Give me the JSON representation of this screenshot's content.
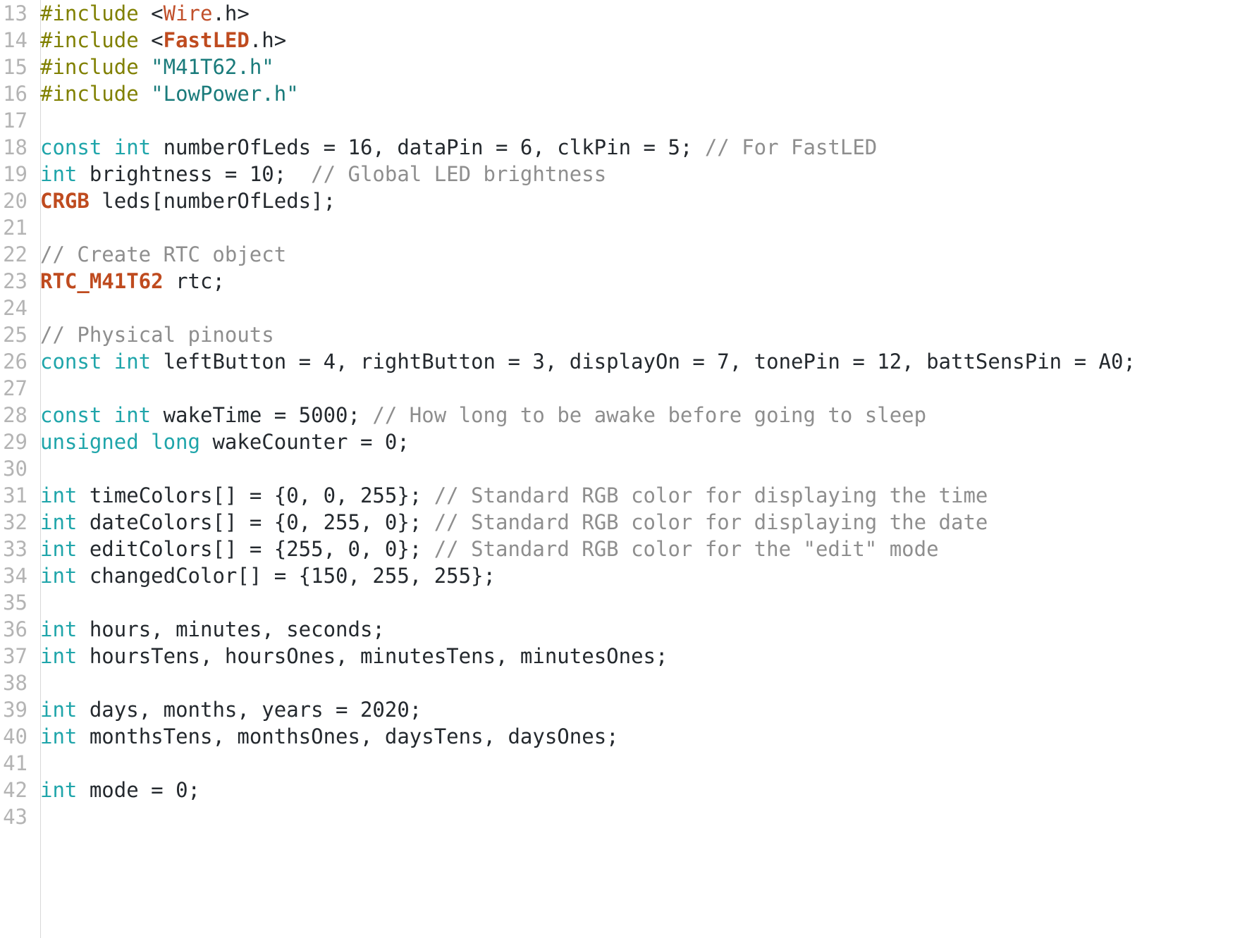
{
  "view": {
    "kind": "source-code-listing",
    "language": "C++ (Arduino)",
    "background_color": "#ffffff",
    "gutter_divider_color": "#d8d8d8",
    "line_number_color": "#b4b4b4"
  },
  "theme_colors": {
    "preprocessor": "#808000",
    "type": "#c1502b",
    "type_bold": "#bf4b1f",
    "string": "#1a7b7b",
    "keyword": "#1fa5aa",
    "comment": "#8e8e8e",
    "plain": "#24292e"
  },
  "lines": [
    {
      "number": "13",
      "tokens": [
        {
          "cls": "t-pre",
          "text": "#include"
        },
        {
          "cls": "t-pln",
          "text": " <"
        },
        {
          "cls": "t-type",
          "text": "Wire"
        },
        {
          "cls": "t-pln",
          "text": ".h>"
        }
      ]
    },
    {
      "number": "14",
      "tokens": [
        {
          "cls": "t-pre",
          "text": "#include"
        },
        {
          "cls": "t-pln",
          "text": " <"
        },
        {
          "cls": "t-typeb",
          "text": "FastLED"
        },
        {
          "cls": "t-pln",
          "text": ".h>"
        }
      ]
    },
    {
      "number": "15",
      "tokens": [
        {
          "cls": "t-pre",
          "text": "#include"
        },
        {
          "cls": "t-pln",
          "text": " "
        },
        {
          "cls": "t-str",
          "text": "\"M41T62.h\""
        }
      ]
    },
    {
      "number": "16",
      "tokens": [
        {
          "cls": "t-pre",
          "text": "#include"
        },
        {
          "cls": "t-pln",
          "text": " "
        },
        {
          "cls": "t-str",
          "text": "\"LowPower.h\""
        }
      ]
    },
    {
      "number": "17",
      "tokens": []
    },
    {
      "number": "18",
      "tokens": [
        {
          "cls": "t-kw",
          "text": "const int"
        },
        {
          "cls": "t-pln",
          "text": " numberOfLeds = 16, dataPin = 6, clkPin = 5; "
        },
        {
          "cls": "t-cmt",
          "text": "// For FastLED"
        }
      ]
    },
    {
      "number": "19",
      "tokens": [
        {
          "cls": "t-kw",
          "text": "int"
        },
        {
          "cls": "t-pln",
          "text": " brightness = 10;  "
        },
        {
          "cls": "t-cmt",
          "text": "// Global LED brightness"
        }
      ]
    },
    {
      "number": "20",
      "tokens": [
        {
          "cls": "t-typeb",
          "text": "CRGB"
        },
        {
          "cls": "t-pln",
          "text": " leds[numberOfLeds];"
        }
      ]
    },
    {
      "number": "21",
      "tokens": []
    },
    {
      "number": "22",
      "tokens": [
        {
          "cls": "t-cmt",
          "text": "// Create RTC object"
        }
      ]
    },
    {
      "number": "23",
      "tokens": [
        {
          "cls": "t-typeb",
          "text": "RTC_M41T62"
        },
        {
          "cls": "t-pln",
          "text": " rtc;"
        }
      ]
    },
    {
      "number": "24",
      "tokens": []
    },
    {
      "number": "25",
      "tokens": [
        {
          "cls": "t-cmt",
          "text": "// Physical pinouts"
        }
      ]
    },
    {
      "number": "26",
      "tokens": [
        {
          "cls": "t-kw",
          "text": "const int"
        },
        {
          "cls": "t-pln",
          "text": " leftButton = 4, rightButton = 3, displayOn = 7, tonePin = 12, battSensPin = A0;"
        }
      ]
    },
    {
      "number": "27",
      "tokens": []
    },
    {
      "number": "28",
      "tokens": [
        {
          "cls": "t-kw",
          "text": "const int"
        },
        {
          "cls": "t-pln",
          "text": " wakeTime = 5000; "
        },
        {
          "cls": "t-cmt",
          "text": "// How long to be awake before going to sleep"
        }
      ]
    },
    {
      "number": "29",
      "tokens": [
        {
          "cls": "t-kw",
          "text": "unsigned long"
        },
        {
          "cls": "t-pln",
          "text": " wakeCounter = 0;"
        }
      ]
    },
    {
      "number": "30",
      "tokens": []
    },
    {
      "number": "31",
      "tokens": [
        {
          "cls": "t-kw",
          "text": "int"
        },
        {
          "cls": "t-pln",
          "text": " timeColors[] = {0, 0, 255}; "
        },
        {
          "cls": "t-cmt",
          "text": "// Standard RGB color for displaying the time"
        }
      ]
    },
    {
      "number": "32",
      "tokens": [
        {
          "cls": "t-kw",
          "text": "int"
        },
        {
          "cls": "t-pln",
          "text": " dateColors[] = {0, 255, 0}; "
        },
        {
          "cls": "t-cmt",
          "text": "// Standard RGB color for displaying the date"
        }
      ]
    },
    {
      "number": "33",
      "tokens": [
        {
          "cls": "t-kw",
          "text": "int"
        },
        {
          "cls": "t-pln",
          "text": " editColors[] = {255, 0, 0}; "
        },
        {
          "cls": "t-cmt",
          "text": "// Standard RGB color for the \"edit\" mode"
        }
      ]
    },
    {
      "number": "34",
      "tokens": [
        {
          "cls": "t-kw",
          "text": "int"
        },
        {
          "cls": "t-pln",
          "text": " changedColor[] = {150, 255, 255};"
        }
      ]
    },
    {
      "number": "35",
      "tokens": []
    },
    {
      "number": "36",
      "tokens": [
        {
          "cls": "t-kw",
          "text": "int"
        },
        {
          "cls": "t-pln",
          "text": " hours, minutes, seconds;"
        }
      ]
    },
    {
      "number": "37",
      "tokens": [
        {
          "cls": "t-kw",
          "text": "int"
        },
        {
          "cls": "t-pln",
          "text": " hoursTens, hoursOnes, minutesTens, minutesOnes;"
        }
      ]
    },
    {
      "number": "38",
      "tokens": []
    },
    {
      "number": "39",
      "tokens": [
        {
          "cls": "t-kw",
          "text": "int"
        },
        {
          "cls": "t-pln",
          "text": " days, months, years = 2020;"
        }
      ]
    },
    {
      "number": "40",
      "tokens": [
        {
          "cls": "t-kw",
          "text": "int"
        },
        {
          "cls": "t-pln",
          "text": " monthsTens, monthsOnes, daysTens, daysOnes;"
        }
      ]
    },
    {
      "number": "41",
      "tokens": []
    },
    {
      "number": "42",
      "tokens": [
        {
          "cls": "t-kw",
          "text": "int"
        },
        {
          "cls": "t-pln",
          "text": " mode = 0;"
        }
      ]
    },
    {
      "number": "43",
      "tokens": []
    }
  ]
}
